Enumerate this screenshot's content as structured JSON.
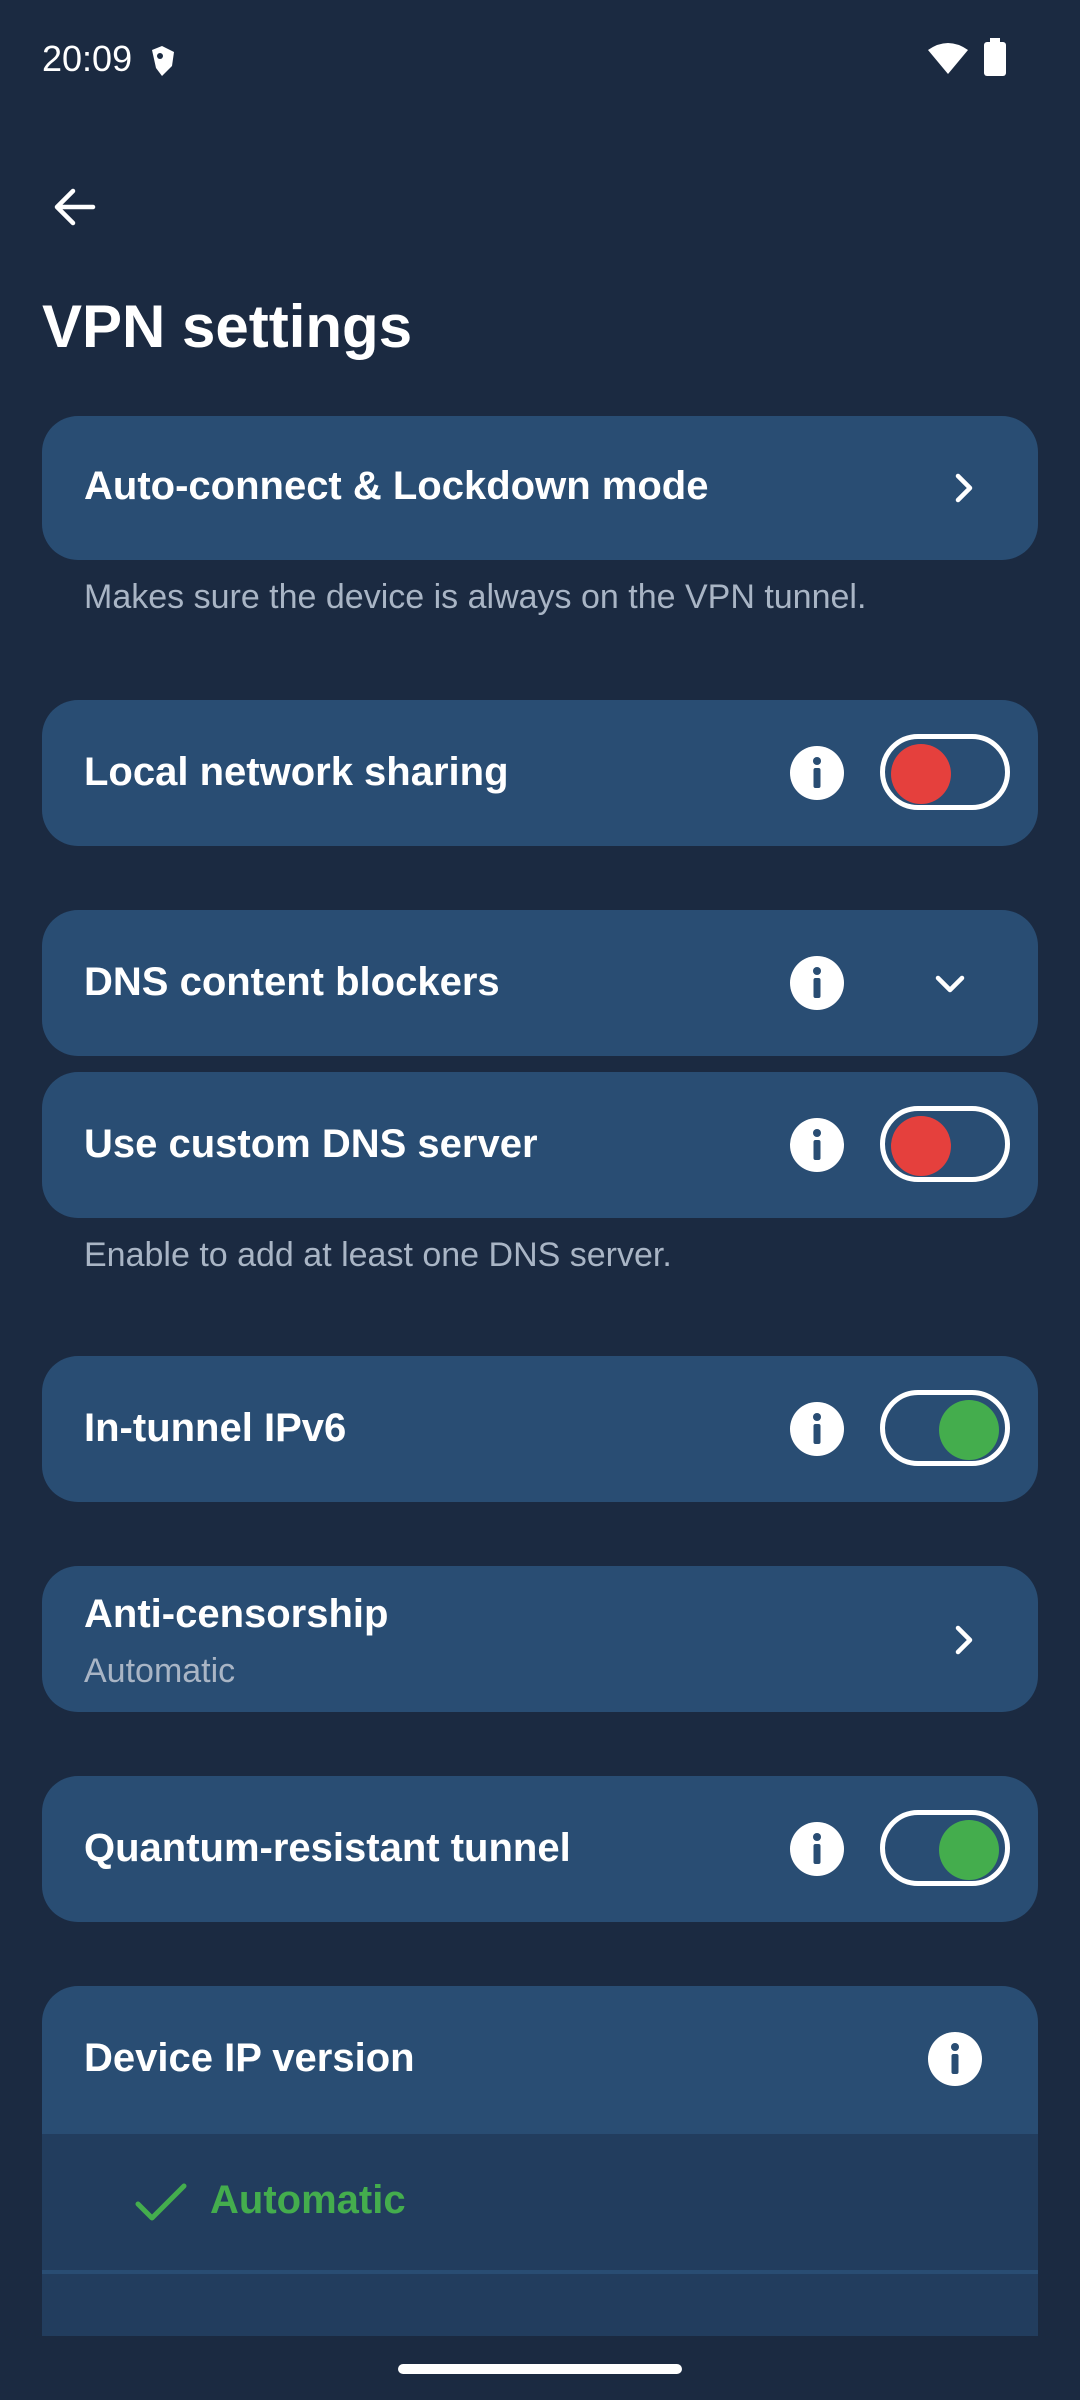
{
  "status_bar": {
    "time": "20:09",
    "notification_icon": "shield-notification-icon",
    "wifi_icon": "wifi-icon",
    "battery_icon": "battery-icon"
  },
  "header": {
    "back_icon": "arrow-left-icon",
    "title": "VPN settings"
  },
  "settings": {
    "auto_connect": {
      "label": "Auto-connect & Lockdown mode",
      "helper": "Makes sure the device is always on the VPN tunnel."
    },
    "local_network_sharing": {
      "label": "Local network sharing",
      "enabled": false
    },
    "dns_content_blockers": {
      "label": "DNS content blockers",
      "expanded": false
    },
    "custom_dns": {
      "label": "Use custom DNS server",
      "enabled": false,
      "helper": "Enable to add at least one DNS server."
    },
    "in_tunnel_ipv6": {
      "label": "In-tunnel IPv6",
      "enabled": true
    },
    "anti_censorship": {
      "label": "Anti-censorship",
      "value": "Automatic"
    },
    "quantum_resistant": {
      "label": "Quantum-resistant tunnel",
      "enabled": true
    },
    "device_ip_version": {
      "label": "Device IP version",
      "selected_option": "Automatic"
    }
  },
  "colors": {
    "background": "#1b2a41",
    "card": "#294d73",
    "toggle_off": "#e5403d",
    "toggle_on": "#44ad4d",
    "helper_text": "#a9b5c5"
  }
}
